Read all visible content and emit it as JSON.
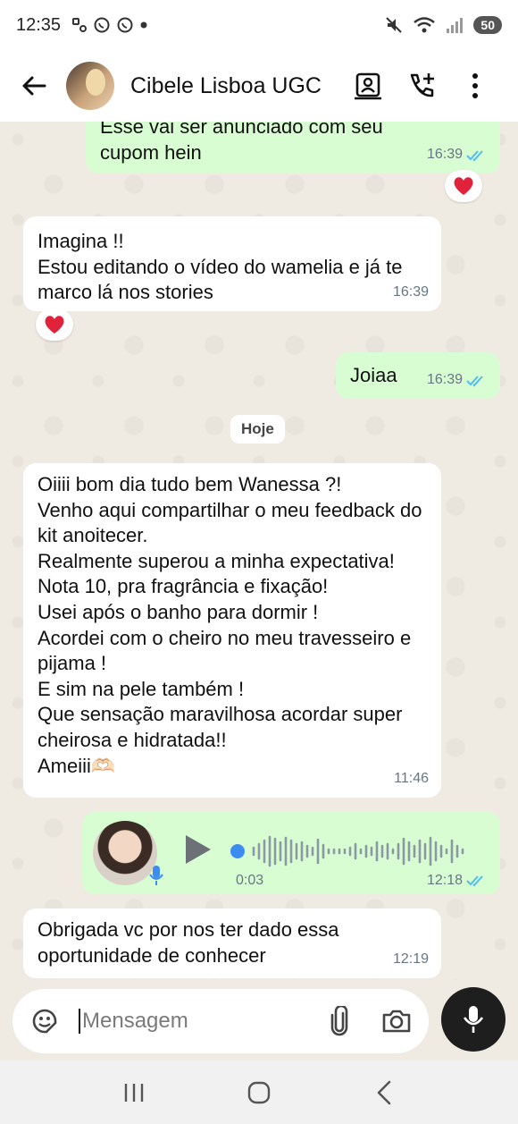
{
  "status_bar": {
    "time": "12:35",
    "battery": "50"
  },
  "header": {
    "contact_name": "Cibele Lisboa UGC"
  },
  "messages": [
    {
      "direction": "outgoing",
      "text": "Esse vai ser anunciado com seu cupom hein",
      "time": "16:39",
      "reaction": "heart"
    },
    {
      "direction": "incoming",
      "text": "Imagina !!\nEstou editando o vídeo do wamelia e já te marco lá nos stories",
      "time": "16:39",
      "reaction": "heart"
    },
    {
      "direction": "outgoing",
      "text": "Joiaa",
      "time": "16:39"
    },
    {
      "direction": "incoming",
      "text": "Oiiii bom dia tudo bem Wanessa ?!\nVenho aqui compartilhar o meu feedback do kit anoitecer.\nRealmente superou a minha expectativa!\nNota 10, pra fragrância e fixação!\nUsei após o banho para dormir !\nAcordei com o cheiro no meu travesseiro e pijama !\nE sim na pele também !\nQue sensação maravilhosa acordar super cheirosa e hidratada!!\nAmeiii🫶🏻",
      "time": "11:46"
    },
    {
      "direction": "outgoing",
      "type": "voice",
      "duration": "0:03",
      "time": "12:18"
    },
    {
      "direction": "incoming",
      "text": "Obrigada vc por nos ter dado essa oportunidade de conhecer",
      "time": "12:19"
    }
  ],
  "date_separator": "Hoje",
  "input": {
    "placeholder": "Mensagem"
  },
  "colors": {
    "chat_background": "#efeae2",
    "outgoing_bubble": "#d9fdd3",
    "incoming_bubble": "#ffffff",
    "read_ticks": "#53bdeb",
    "reaction_heart": "#e0223a"
  },
  "icons": {
    "header": [
      "back-arrow-icon",
      "contact-card-icon",
      "add-call-icon",
      "more-vert-icon"
    ],
    "input": [
      "sticker-icon",
      "attach-icon",
      "camera-icon",
      "mic-icon"
    ],
    "nav": [
      "recents-icon",
      "home-icon",
      "back-icon"
    ]
  }
}
